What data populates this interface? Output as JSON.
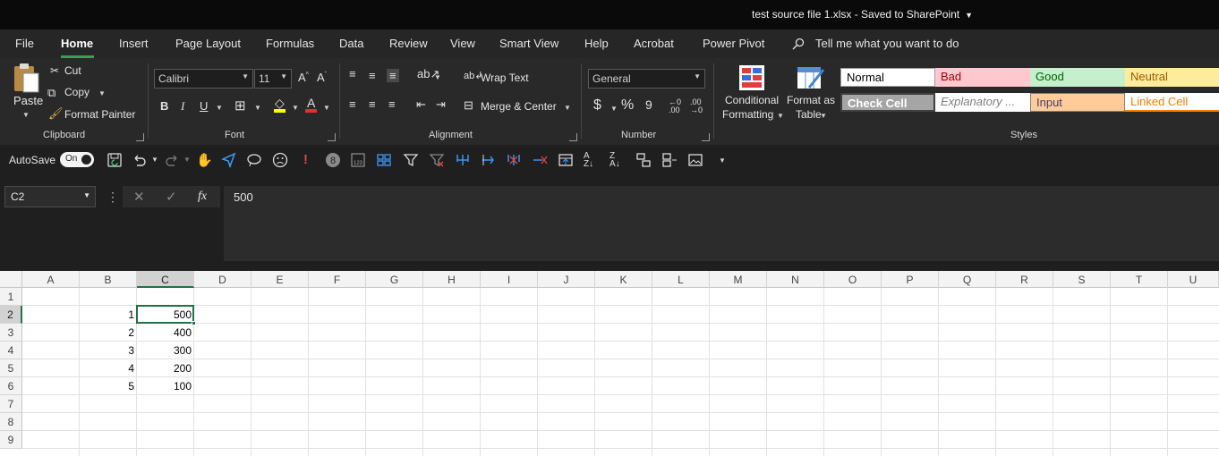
{
  "window": {
    "title": "test source file 1.xlsx  -  Saved to SharePoint"
  },
  "menu": {
    "tabs": [
      "File",
      "Home",
      "Insert",
      "Page Layout",
      "Formulas",
      "Data",
      "Review",
      "View",
      "Smart View",
      "Help",
      "Acrobat",
      "Power Pivot"
    ],
    "active": "Home",
    "tell_me": "Tell me what you want to do"
  },
  "ribbon": {
    "clipboard": {
      "paste": "Paste",
      "cut": "Cut",
      "copy": "Copy",
      "format_painter": "Format Painter",
      "label": "Clipboard"
    },
    "font": {
      "family": "Calibri",
      "size": "11",
      "bold": "B",
      "italic": "I",
      "underline": "U",
      "label": "Font"
    },
    "alignment": {
      "wrap_text": "Wrap Text",
      "merge_center": "Merge & Center",
      "label": "Alignment"
    },
    "number": {
      "format": "General",
      "currency": "$",
      "percent": "%",
      "comma": "9",
      "label": "Number"
    },
    "styles": {
      "conditional": "Conditional",
      "formatting": "Formatting",
      "format_as": "Format as",
      "table": "Table",
      "cells": [
        {
          "name": "Normal",
          "bg": "#ffffff",
          "fg": "#000000"
        },
        {
          "name": "Bad",
          "bg": "#ffc7ce",
          "fg": "#9c0006"
        },
        {
          "name": "Good",
          "bg": "#c6efce",
          "fg": "#006100"
        },
        {
          "name": "Neutral",
          "bg": "#ffeb9c",
          "fg": "#9c5700"
        },
        {
          "name": "Check Cell",
          "bg": "#a5a5a5",
          "fg": "#ffffff"
        },
        {
          "name": "Explanatory ...",
          "bg": "#ffffff",
          "fg": "#7f7f7f"
        },
        {
          "name": "Input",
          "bg": "#ffcc99",
          "fg": "#3f3f76"
        },
        {
          "name": "Linked Cell",
          "bg": "#ffffff",
          "fg": "#fa7d00"
        }
      ],
      "label": "Styles"
    }
  },
  "qat": {
    "autosave": "AutoSave",
    "toggle": "On"
  },
  "formula_bar": {
    "name_box": "C2",
    "fx": "fx",
    "value": "500"
  },
  "sheet": {
    "columns": [
      "A",
      "B",
      "C",
      "D",
      "E",
      "F",
      "G",
      "H",
      "I",
      "J",
      "K",
      "L",
      "M",
      "N",
      "O",
      "P",
      "Q",
      "R",
      "S",
      "T",
      "U"
    ],
    "rows": [
      "1",
      "2",
      "3",
      "4",
      "5",
      "6",
      "7",
      "8",
      "9"
    ],
    "selected_cell": "C2",
    "colB": [
      "",
      "1",
      "2",
      "3",
      "4",
      "5",
      "",
      "",
      ""
    ],
    "colC": [
      "",
      "500",
      "400",
      "300",
      "200",
      "100",
      "",
      "",
      ""
    ]
  },
  "colors": {
    "accent": "#217346",
    "ribbon_bg": "#292929",
    "title_bg": "#0a0a0a"
  }
}
